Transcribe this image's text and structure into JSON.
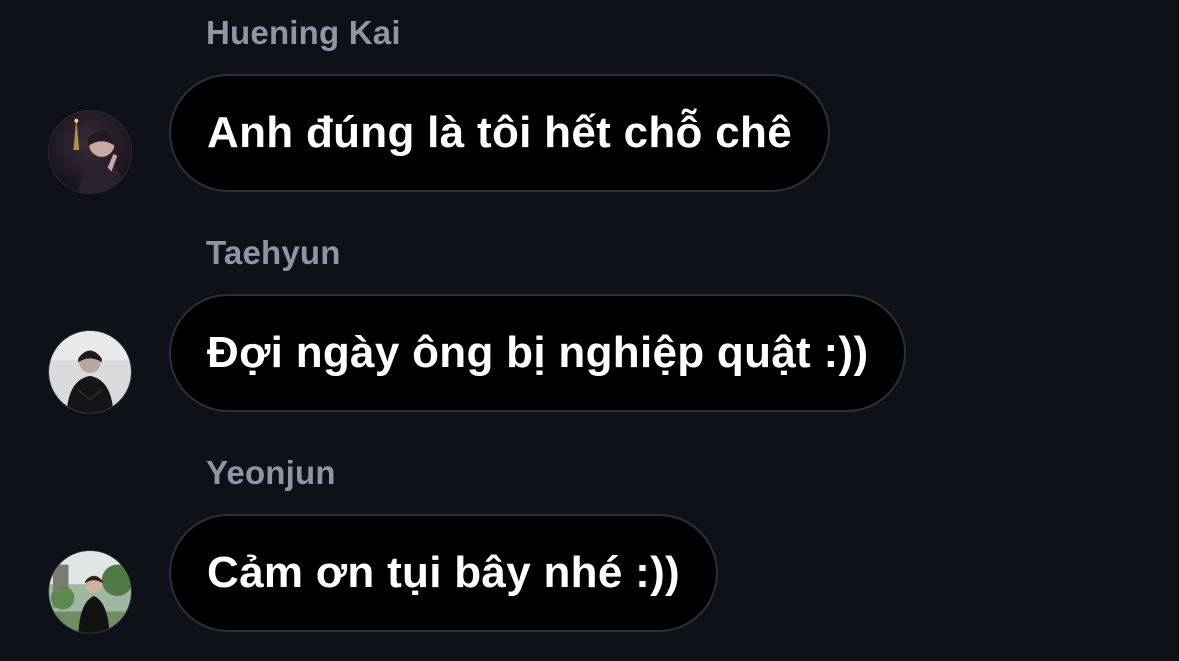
{
  "messages": [
    {
      "sender": "Huening Kai",
      "text": "Anh đúng là tôi hết chỗ chê",
      "avatar_icon": "avatar-photo-night-city"
    },
    {
      "sender": "Taehyun",
      "text": "Đợi ngày ông bị nghiệp quật :))",
      "avatar_icon": "avatar-photo-grey-portrait"
    },
    {
      "sender": "Yeonjun",
      "text": "Cảm ơn tụi bây nhé :))",
      "avatar_icon": "avatar-photo-outdoor-park"
    }
  ],
  "colors": {
    "background": "#0e1117",
    "bubble": "#000000",
    "bubble_border": "#2b2f37",
    "sender_name": "#8e95a3",
    "message_text": "#ffffff"
  }
}
